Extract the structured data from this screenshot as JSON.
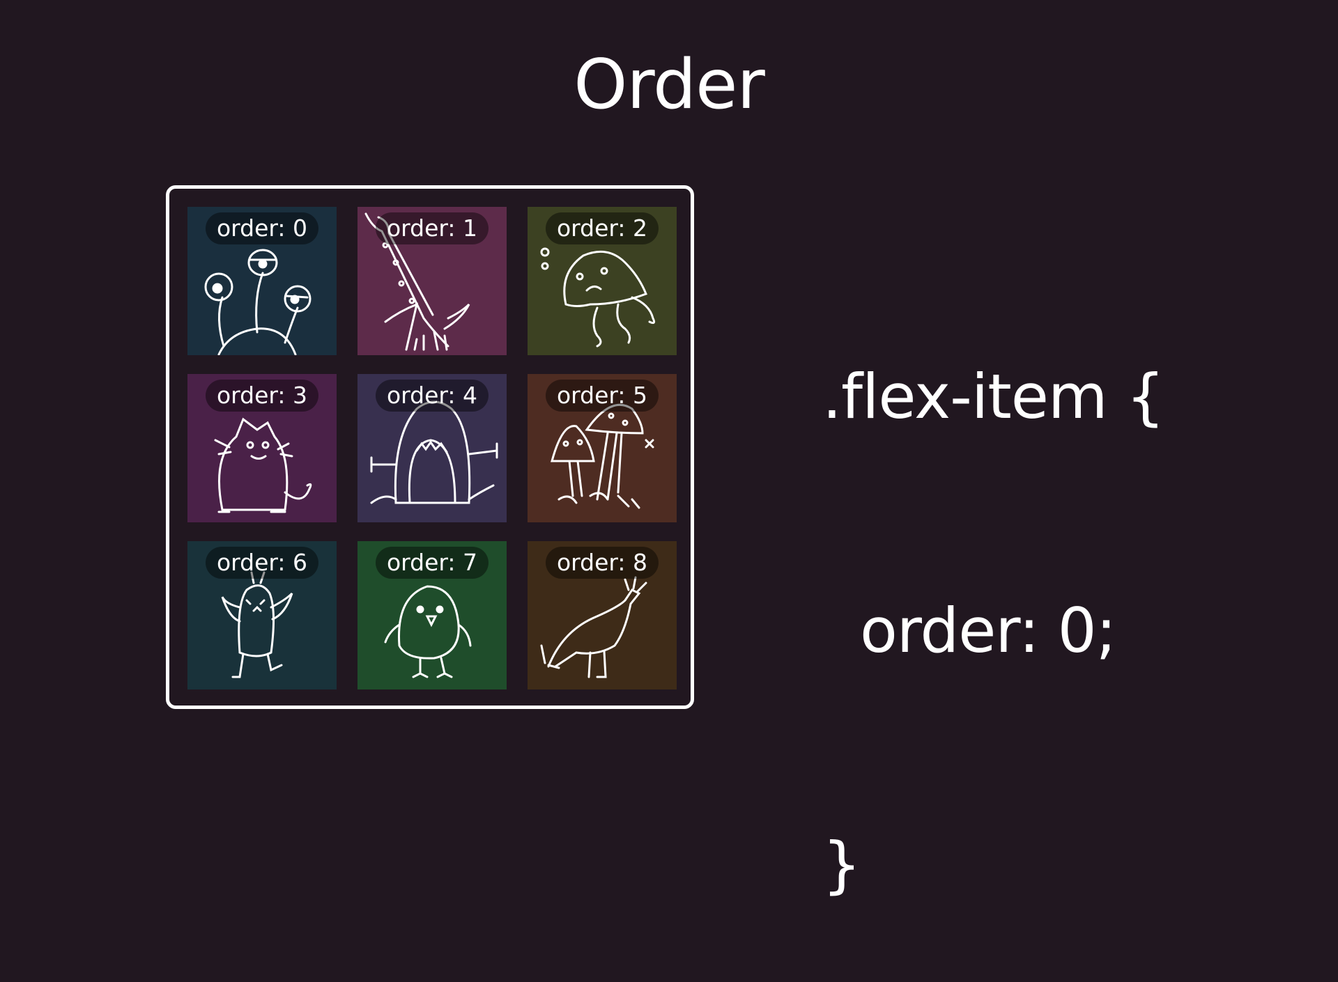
{
  "slide": {
    "title": "Order"
  },
  "items": [
    {
      "label": "order: 0",
      "color": "#1a2f3e",
      "drawing": "three-eyestalk-creature-icon"
    },
    {
      "label": "order: 1",
      "color": "#5d2b4a",
      "drawing": "giraffe-neck-creature-icon"
    },
    {
      "label": "order: 2",
      "color": "#3c4122",
      "drawing": "jellyfish-icon"
    },
    {
      "label": "order: 3",
      "color": "#4a2148",
      "drawing": "cat-icon"
    },
    {
      "label": "order: 4",
      "color": "#38304f",
      "drawing": "open-mouth-monster-icon"
    },
    {
      "label": "order: 5",
      "color": "#4e2c22",
      "drawing": "mushrooms-icon"
    },
    {
      "label": "order: 6",
      "color": "#19323a",
      "drawing": "winged-creature-icon"
    },
    {
      "label": "order: 7",
      "color": "#1f4d2b",
      "drawing": "bird-icon"
    },
    {
      "label": "order: 8",
      "color": "#3e2b18",
      "drawing": "crested-bird-icon"
    }
  ],
  "code": {
    "line1": ".flex-item {",
    "line2": "  order: 0;",
    "line3": "}"
  }
}
